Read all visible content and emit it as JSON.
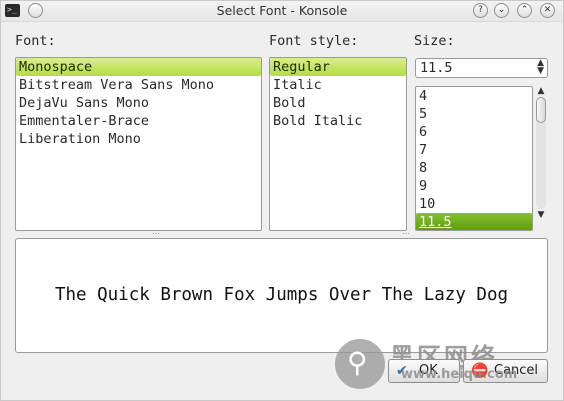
{
  "window": {
    "title": "Select Font - Konsole",
    "app_icon": "terminal-icon",
    "titlebar_buttons": [
      "?",
      "⌄",
      "⌃",
      "✕"
    ]
  },
  "font_panel": {
    "label": "Font:",
    "selected": "Monospace",
    "items": [
      "Monospace",
      "Bitstream Vera Sans Mono",
      "DejaVu Sans Mono",
      "Emmentaler-Brace",
      "Liberation Mono"
    ]
  },
  "style_panel": {
    "label": "Font style:",
    "selected": "Regular",
    "items": [
      "Regular",
      "Italic",
      "Bold",
      "Bold Italic"
    ]
  },
  "size_panel": {
    "label": "Size:",
    "value": "11.5",
    "items": [
      "4",
      "5",
      "6",
      "7",
      "8",
      "9",
      "10",
      "11.5"
    ],
    "selected": "11.5"
  },
  "preview": {
    "text": "The Quick Brown Fox Jumps Over The Lazy Dog"
  },
  "buttons": {
    "ok": "OK",
    "cancel": "Cancel"
  },
  "watermark": {
    "cn": "黑区网络",
    "url": "www.heiqu.com"
  },
  "colors": {
    "selection": "#c6e36a",
    "size_selection": "#6fad1c"
  }
}
